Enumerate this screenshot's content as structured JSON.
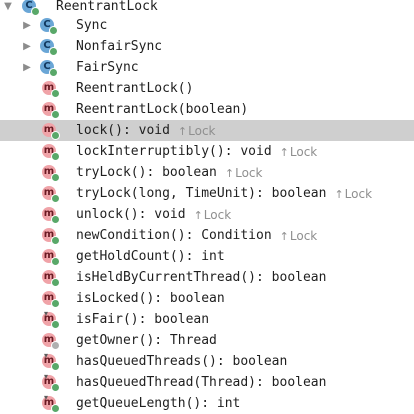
{
  "tree": {
    "root": {
      "label": "ReentrantLock",
      "icon": "class-icon",
      "arrow": "▼"
    },
    "nested": [
      {
        "label": "Sync",
        "icon": "class-icon",
        "arrow": "▶"
      },
      {
        "label": "NonfairSync",
        "icon": "class-icon",
        "arrow": "▶"
      },
      {
        "label": "FairSync",
        "icon": "class-icon",
        "arrow": "▶"
      }
    ],
    "methods": [
      {
        "label": "ReentrantLock()",
        "inherited": "",
        "selected": false
      },
      {
        "label": "ReentrantLock(boolean)",
        "inherited": "",
        "selected": false
      },
      {
        "label": "lock(): void",
        "inherited": "Lock",
        "selected": true
      },
      {
        "label": "lockInterruptibly(): void",
        "inherited": "Lock",
        "selected": false
      },
      {
        "label": "tryLock(): boolean",
        "inherited": "Lock",
        "selected": false
      },
      {
        "label": "tryLock(long, TimeUnit): boolean",
        "inherited": "Lock",
        "selected": false
      },
      {
        "label": "unlock(): void",
        "inherited": "Lock",
        "selected": false
      },
      {
        "label": "newCondition(): Condition",
        "inherited": "Lock",
        "selected": false
      },
      {
        "label": "getHoldCount(): int",
        "inherited": "",
        "selected": false
      },
      {
        "label": "isHeldByCurrentThread(): boolean",
        "inherited": "",
        "selected": false
      },
      {
        "label": "isLocked(): boolean",
        "inherited": "",
        "selected": false
      },
      {
        "label": "isFair(): boolean",
        "inherited": "",
        "selected": false
      },
      {
        "label": "getOwner(): Thread",
        "inherited": "",
        "selected": false
      },
      {
        "label": "hasQueuedThreads(): boolean",
        "inherited": "",
        "selected": false
      },
      {
        "label": "hasQueuedThread(Thread): boolean",
        "inherited": "",
        "selected": false
      },
      {
        "label": "getQueueLength(): int",
        "inherited": "",
        "selected": false
      }
    ],
    "inherited_arrow": "↑",
    "class_glyph": "C",
    "method_glyph": "m",
    "pin_glyph": "▾"
  },
  "colors": {
    "selection": "#cfcfcf",
    "method_icon": "#f0a3a8",
    "class_icon": "#6aa6d6",
    "public_modifier": "#59a869",
    "inherited_text": "#8f8f8f"
  }
}
